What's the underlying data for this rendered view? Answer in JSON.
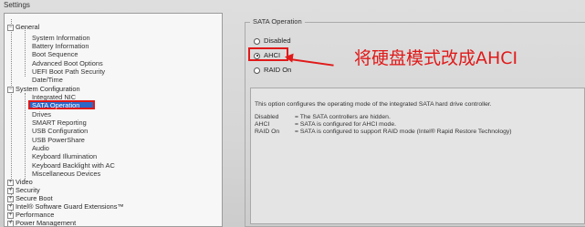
{
  "settings": {
    "title": "Settings",
    "tree": [
      {
        "label": "General",
        "level": 0,
        "expander": "−"
      },
      {
        "label": "System Information",
        "level": 1
      },
      {
        "label": "Battery Information",
        "level": 1
      },
      {
        "label": "Boot Sequence",
        "level": 1
      },
      {
        "label": "Advanced Boot Options",
        "level": 1
      },
      {
        "label": "UEFI Boot Path Security",
        "level": 1
      },
      {
        "label": "Date/Time",
        "level": 1
      },
      {
        "label": "System Configuration",
        "level": 0,
        "expander": "−"
      },
      {
        "label": "Integrated NIC",
        "level": 1
      },
      {
        "label": "SATA Operation",
        "level": 1,
        "selected": true
      },
      {
        "label": "Drives",
        "level": 1
      },
      {
        "label": "SMART Reporting",
        "level": 1
      },
      {
        "label": "USB Configuration",
        "level": 1
      },
      {
        "label": "USB PowerShare",
        "level": 1
      },
      {
        "label": "Audio",
        "level": 1
      },
      {
        "label": "Keyboard Illumination",
        "level": 1
      },
      {
        "label": "Keyboard Backlight with AC",
        "level": 1
      },
      {
        "label": "Miscellaneous Devices",
        "level": 1
      },
      {
        "label": "Video",
        "level": 0,
        "expander": "+"
      },
      {
        "label": "Security",
        "level": 0,
        "expander": "+"
      },
      {
        "label": "Secure Boot",
        "level": 0,
        "expander": "+"
      },
      {
        "label": "Intel® Software Guard Extensions™",
        "level": 0,
        "expander": "+"
      },
      {
        "label": "Performance",
        "level": 0,
        "expander": "+"
      },
      {
        "label": "Power Management",
        "level": 0,
        "expander": "+"
      }
    ]
  },
  "sata": {
    "group_title": "SATA Operation",
    "options": [
      {
        "label": "Disabled",
        "selected": false
      },
      {
        "label": "AHCI",
        "selected": true
      },
      {
        "label": "RAID On",
        "selected": false
      }
    ],
    "annotation": "将硬盘模式改成AHCI",
    "annotation_color": "#e01919",
    "description": "This option configures the operating mode of the integrated SATA hard drive controller.",
    "option_details": [
      {
        "name": "Disabled",
        "text": "= The SATA controllers are hidden."
      },
      {
        "name": "AHCI",
        "text": "= SATA is configured for AHCI mode."
      },
      {
        "name": "RAID On",
        "text": "= SATA is configured to support RAID mode (Intel® Rapid Restore Technology)"
      }
    ]
  },
  "colors": {
    "highlight": "#e01919",
    "selection": "#2c68c8"
  }
}
